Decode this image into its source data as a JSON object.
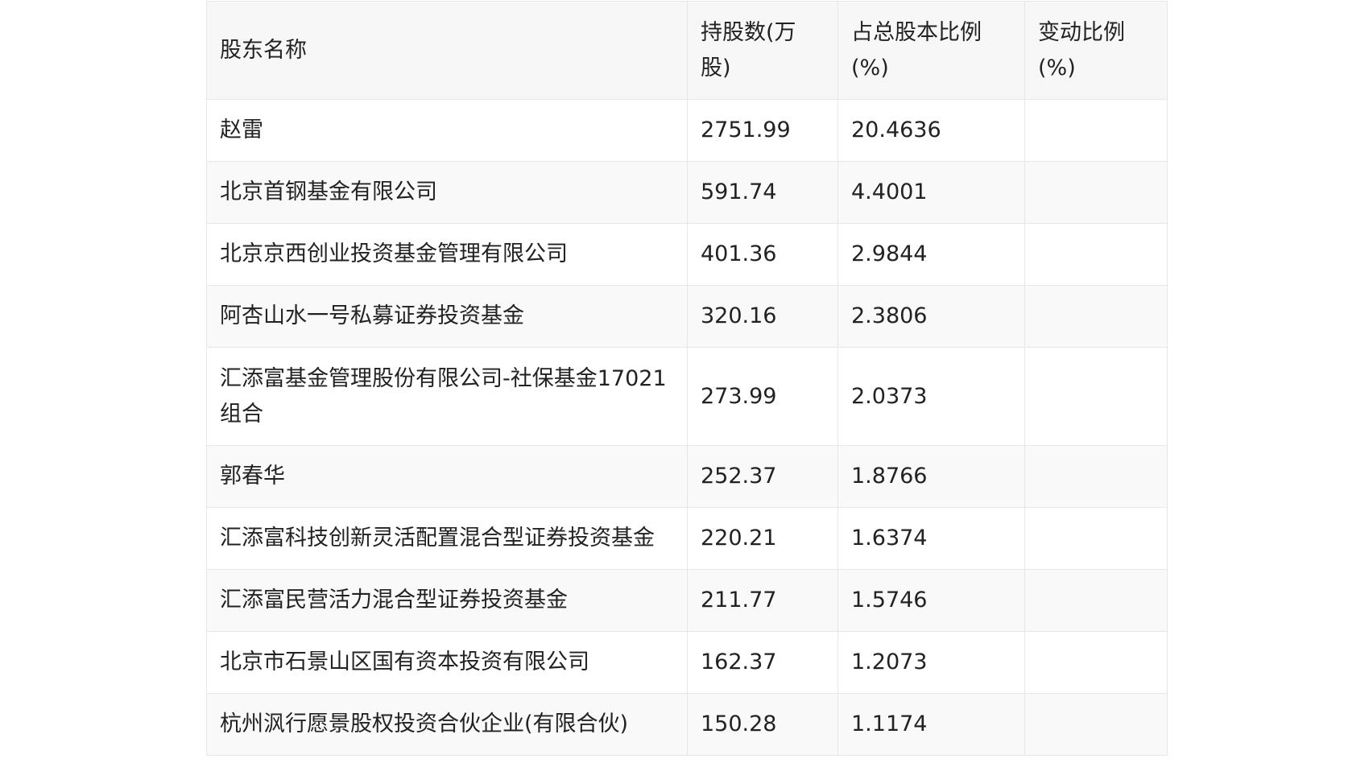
{
  "table": {
    "headers": [
      "股东名称",
      "持股数(万股)",
      "占总股本比例(%)",
      "变动比例(%)"
    ],
    "rows": [
      {
        "name": "赵雷",
        "shares": "2751.99",
        "ratio": "20.4636",
        "change": ""
      },
      {
        "name": "北京首钢基金有限公司",
        "shares": "591.74",
        "ratio": "4.4001",
        "change": ""
      },
      {
        "name": "北京京西创业投资基金管理有限公司",
        "shares": "401.36",
        "ratio": "2.9844",
        "change": ""
      },
      {
        "name": "阿杏山水一号私募证券投资基金",
        "shares": "320.16",
        "ratio": "2.3806",
        "change": ""
      },
      {
        "name": "汇添富基金管理股份有限公司-社保基金17021组合",
        "shares": "273.99",
        "ratio": "2.0373",
        "change": ""
      },
      {
        "name": "郭春华",
        "shares": "252.37",
        "ratio": "1.8766",
        "change": ""
      },
      {
        "name": "汇添富科技创新灵活配置混合型证券投资基金",
        "shares": "220.21",
        "ratio": "1.6374",
        "change": ""
      },
      {
        "name": "汇添富民营活力混合型证券投资基金",
        "shares": "211.77",
        "ratio": "1.5746",
        "change": ""
      },
      {
        "name": "北京市石景山区国有资本投资有限公司",
        "shares": "162.37",
        "ratio": "1.2073",
        "change": ""
      },
      {
        "name": "杭州沨行愿景股权投资合伙企业(有限合伙)",
        "shares": "150.28",
        "ratio": "1.1174",
        "change": ""
      }
    ]
  }
}
